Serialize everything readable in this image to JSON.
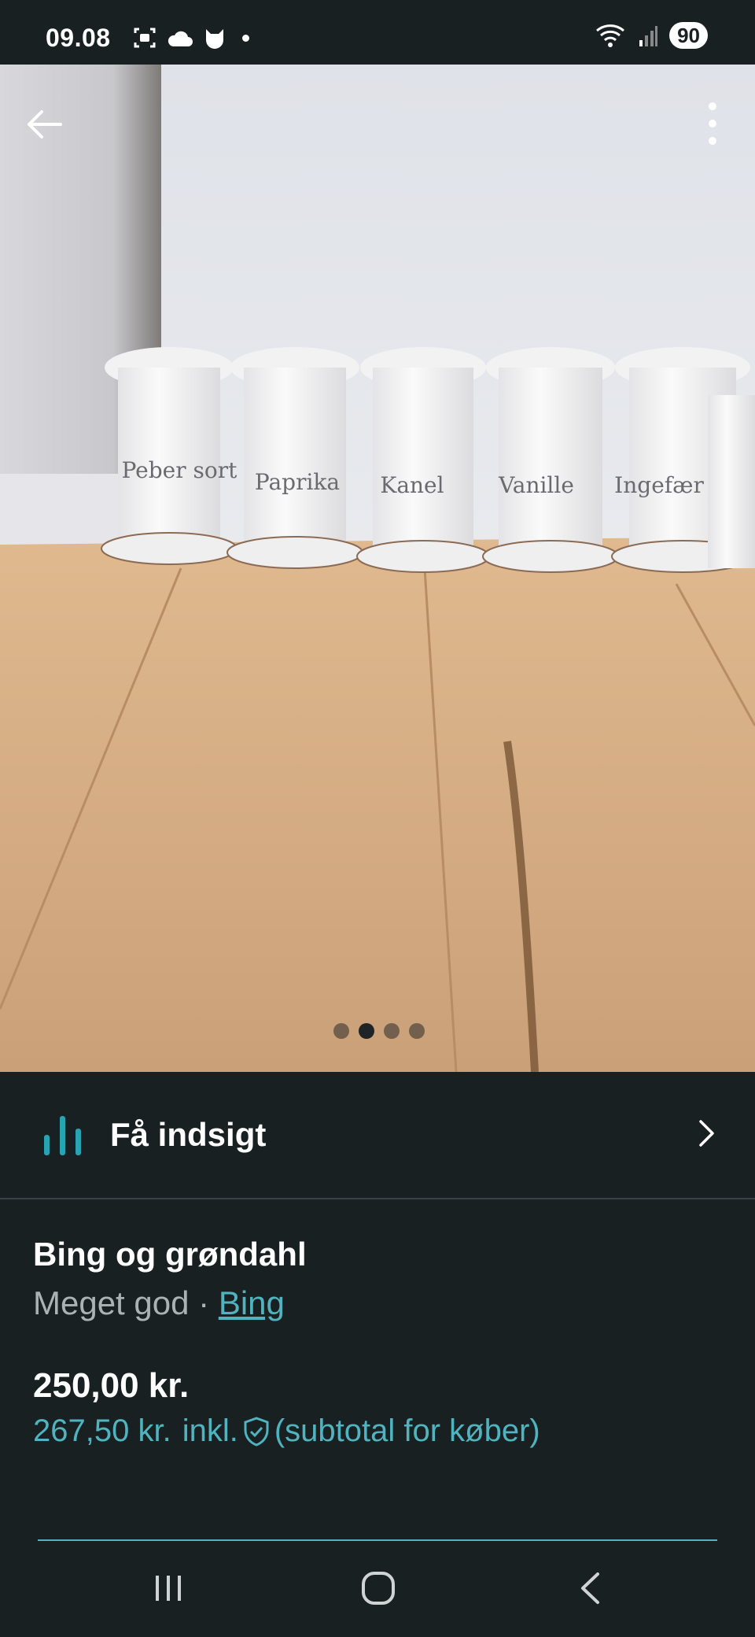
{
  "status_bar": {
    "time": "09.08",
    "battery": "90"
  },
  "gallery": {
    "image_count": 4,
    "active_index": 1,
    "jar_labels": [
      "Peber sort",
      "Paprika",
      "Kanel",
      "Vanille",
      "Ingefær"
    ]
  },
  "insight": {
    "label": "Få indsigt"
  },
  "listing": {
    "title": "Bing og grøndahl",
    "condition": "Meget god",
    "separator": " · ",
    "brand": "Bing",
    "price": "250,00 kr.",
    "price_incl": "267,50 kr.",
    "incl_label": "inkl.",
    "subtotal_note": "(subtotal for køber)"
  },
  "colors": {
    "background": "#182022",
    "accent": "#4fb4bf"
  }
}
